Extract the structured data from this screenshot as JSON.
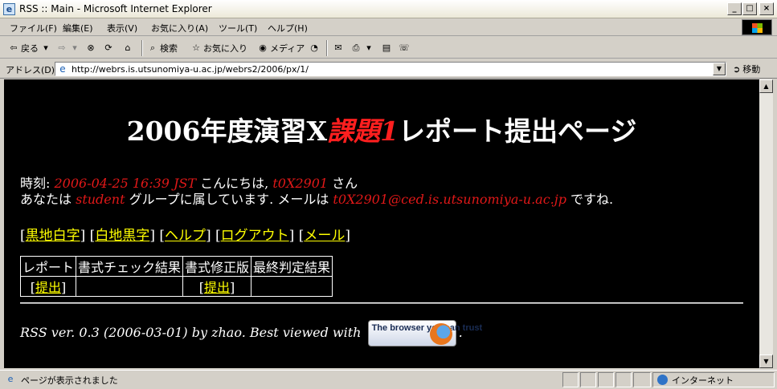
{
  "window": {
    "title": "RSS :: Main - Microsoft Internet Explorer",
    "app_icon": "ie-page-icon",
    "controls": [
      "minimize",
      "maximize",
      "close"
    ]
  },
  "menubar": {
    "items": [
      "ファイル(F)",
      "編集(E)",
      "表示(V)",
      "お気に入り(A)",
      "ツール(T)",
      "ヘルプ(H)"
    ]
  },
  "toolbar": {
    "back": "戻る",
    "search": "検索",
    "favorites": "お気に入り",
    "media": "メディア"
  },
  "address": {
    "label": "アドレス(D)",
    "url": "http://webrs.is.utsunomiya-u.ac.jp/webrs2/2006/px/1/",
    "go": "移動"
  },
  "page": {
    "title_prefix": "2006年度演習X",
    "title_red": "課題1",
    "title_suffix": "レポート提出ページ",
    "time_label": "時刻:",
    "time_value": "2006-04-25 16:39 JST",
    "greeting": "こんにちは,",
    "user_id": "t0X2901",
    "san": "さん",
    "group_prefix": "あなたは",
    "group": "student",
    "group_suffix": "グループに属しています. メールは",
    "email": "t0X2901@ced.is.utsunomiya-u.ac.jp",
    "email_suffix": "ですね.",
    "links": [
      "黒地白字",
      "白地黒字",
      "ヘルプ",
      "ログアウト",
      "メール"
    ],
    "table": {
      "headers": [
        "レポート",
        "書式チェック結果",
        "書式修正版",
        "最終判定結果"
      ],
      "row": [
        "提出",
        "",
        "提出",
        ""
      ]
    },
    "footer_text": "RSS ver. 0.3 (2006-03-01) by zhao. Best viewed with",
    "footer_end": ".",
    "badge_text": "The browser you can trust"
  },
  "status": {
    "message": "ページが表示されました",
    "zone": "インターネット"
  }
}
